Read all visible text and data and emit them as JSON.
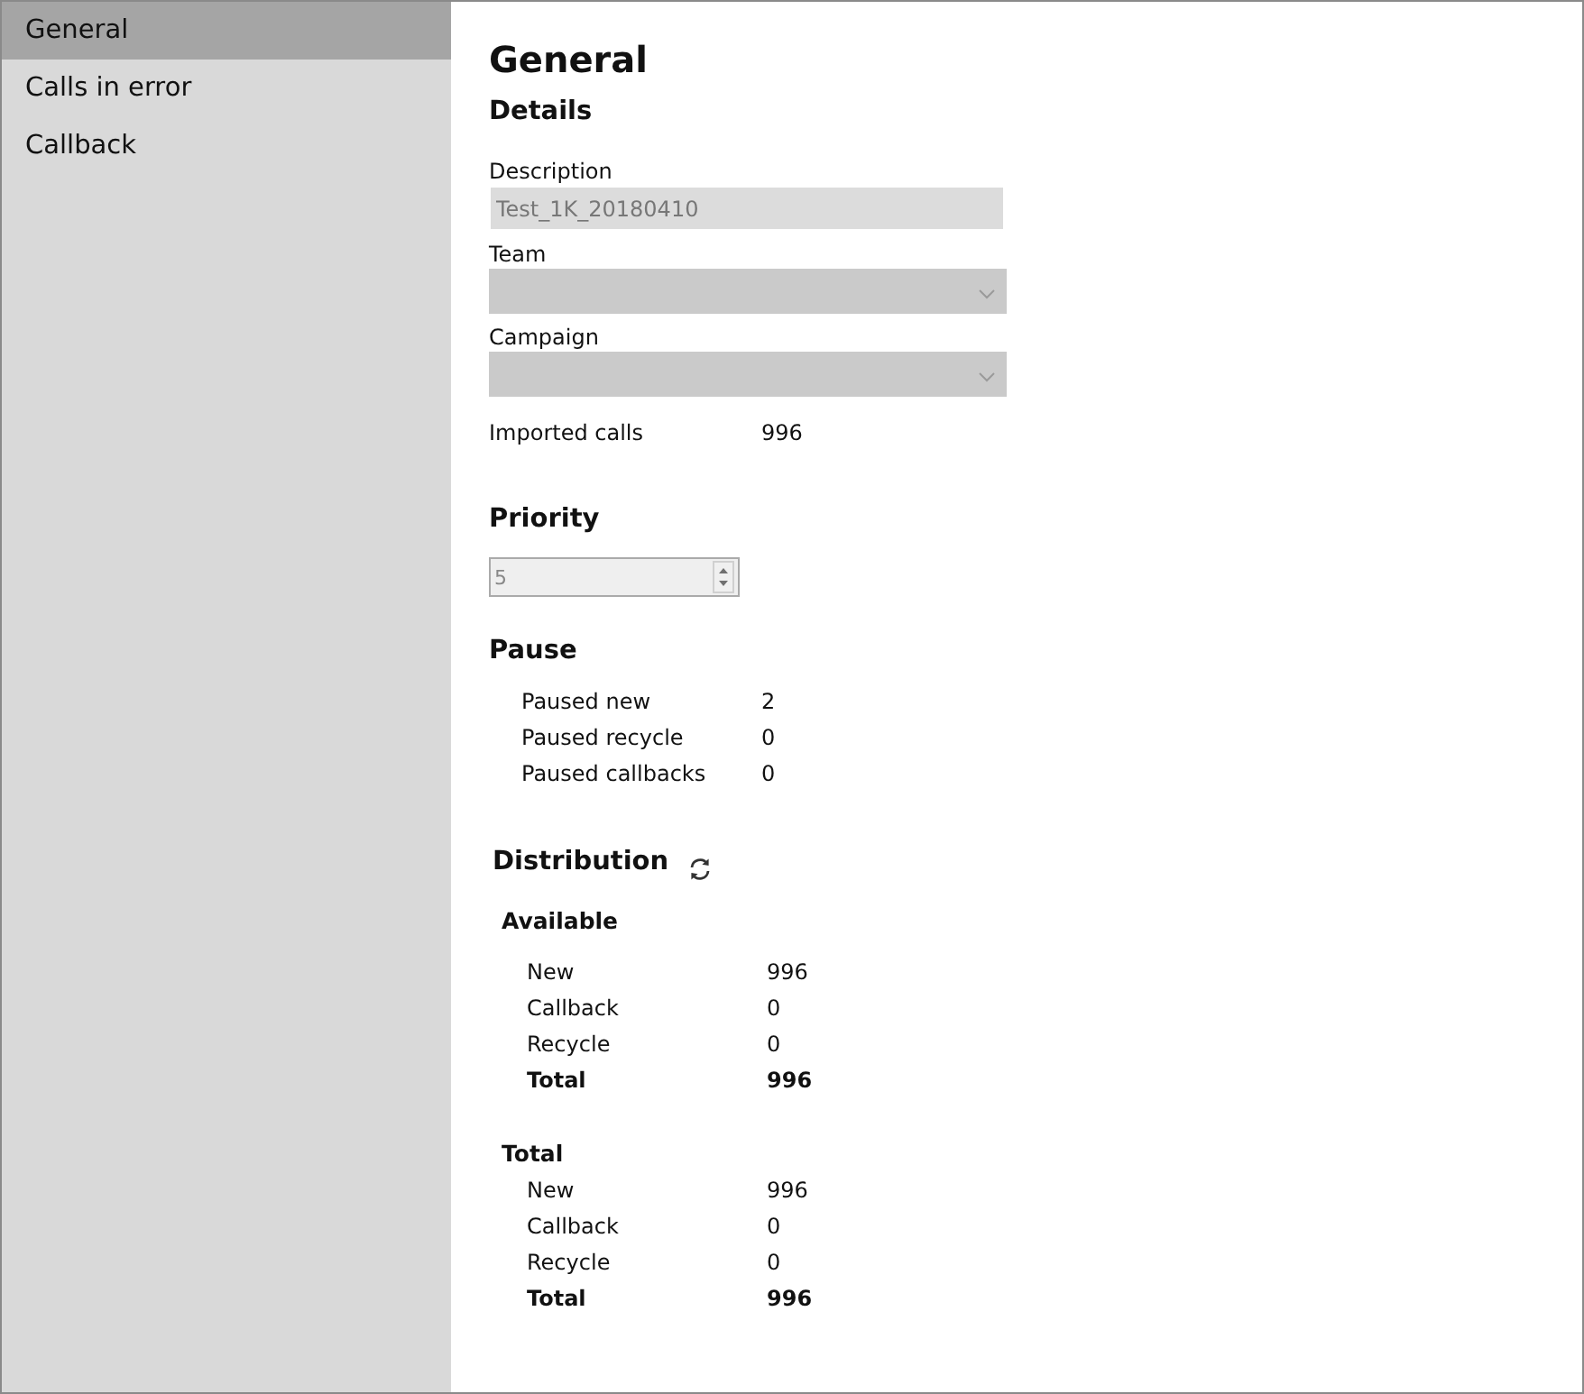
{
  "sidebar": {
    "items": [
      {
        "label": "General",
        "selected": true
      },
      {
        "label": "Calls in error",
        "selected": false
      },
      {
        "label": "Callback",
        "selected": false
      }
    ]
  },
  "title": "General",
  "details": {
    "heading": "Details",
    "fields": [
      {
        "kind": "text",
        "label": "Description",
        "value": "Test_1K_20180410",
        "disabled": true
      },
      {
        "kind": "select",
        "label": "Team",
        "disabled": true
      },
      {
        "kind": "select",
        "label": "Campaign",
        "disabled": true
      }
    ],
    "imported_calls": {
      "label": "Imported calls",
      "value": "996"
    }
  },
  "priority": {
    "heading": "Priority",
    "value": "5",
    "disabled": true
  },
  "pause": {
    "heading": "Pause",
    "rows": [
      {
        "label": "Paused new",
        "value": "2"
      },
      {
        "label": "Paused recycle",
        "value": "0"
      },
      {
        "label": "Paused callbacks",
        "value": "0"
      }
    ]
  },
  "distribution": {
    "heading": "Distribution",
    "groups": [
      {
        "heading": "Available",
        "rows": [
          {
            "kind": "count",
            "label": "New",
            "value": "996"
          },
          {
            "kind": "count",
            "label": "Callback",
            "value": "0"
          },
          {
            "kind": "count",
            "label": "Recycle",
            "value": "0"
          },
          {
            "kind": "total",
            "label": "Total",
            "value": "996"
          }
        ]
      },
      {
        "heading": "Total",
        "rows": [
          {
            "kind": "count",
            "label": "New",
            "value": "996"
          },
          {
            "kind": "count",
            "label": "Callback",
            "value": "0"
          },
          {
            "kind": "count",
            "label": "Recycle",
            "value": "0"
          },
          {
            "kind": "total",
            "label": "Total",
            "value": "996"
          }
        ]
      }
    ]
  }
}
